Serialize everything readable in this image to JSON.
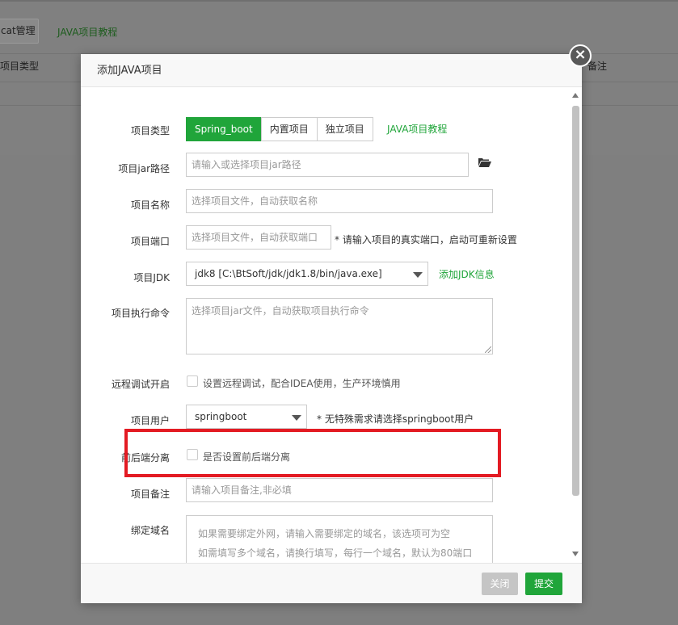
{
  "background": {
    "toolbar_button": "cat管理",
    "tutorial_link": "JAVA项目教程",
    "col_type": "项目类型",
    "col_note": "备注"
  },
  "dialog": {
    "title": "添加JAVA项目",
    "close_icon": "close-icon",
    "project_type": {
      "label": "项目类型",
      "tabs": [
        "Spring_boot",
        "内置项目",
        "独立项目"
      ],
      "active_tab": "Spring_boot",
      "tutorial_link": "JAVA项目教程"
    },
    "jar_path": {
      "label": "项目jar路径",
      "placeholder": "请输入或选择项目jar路径",
      "icon": "folder-open-icon"
    },
    "project_name": {
      "label": "项目名称",
      "placeholder": "选择项目文件，自动获取名称"
    },
    "project_port": {
      "label": "项目端口",
      "placeholder": "选择项目文件，自动获取端口",
      "hint": "* 请输入项目的真实端口，启动可重新设置"
    },
    "project_jdk": {
      "label": "项目JDK",
      "value": "jdk8 [C:\\BtSoft/jdk/jdk1.8/bin/java.exe]",
      "add_link": "添加JDK信息"
    },
    "exec_command": {
      "label": "项目执行命令",
      "placeholder": "选择项目jar文件，自动获取项目执行命令"
    },
    "remote_debug": {
      "label": "远程调试开启",
      "checkbox_label": "设置远程调试，配合IDEA使用，生产环境慎用",
      "checked": false
    },
    "project_user": {
      "label": "项目用户",
      "value": "springboot",
      "hint": "* 无特殊需求请选择springboot用户"
    },
    "separate": {
      "label": "前后端分离",
      "checkbox_label": "是否设置前后端分离",
      "checked": false
    },
    "project_note": {
      "label": "项目备注",
      "placeholder": "请输入项目备注,非必填"
    },
    "bind_domain": {
      "label": "绑定域名",
      "placeholder_line1": "如果需要绑定外网，请输入需要绑定的域名，该选项可为空",
      "placeholder_line2": "如需填写多个域名，请换行填写，每行一个域名，默认为80端口"
    },
    "footer": {
      "close_label": "关闭",
      "submit_label": "提交"
    },
    "highlight_color": "#e31b23",
    "accent_color": "#20a53a"
  }
}
